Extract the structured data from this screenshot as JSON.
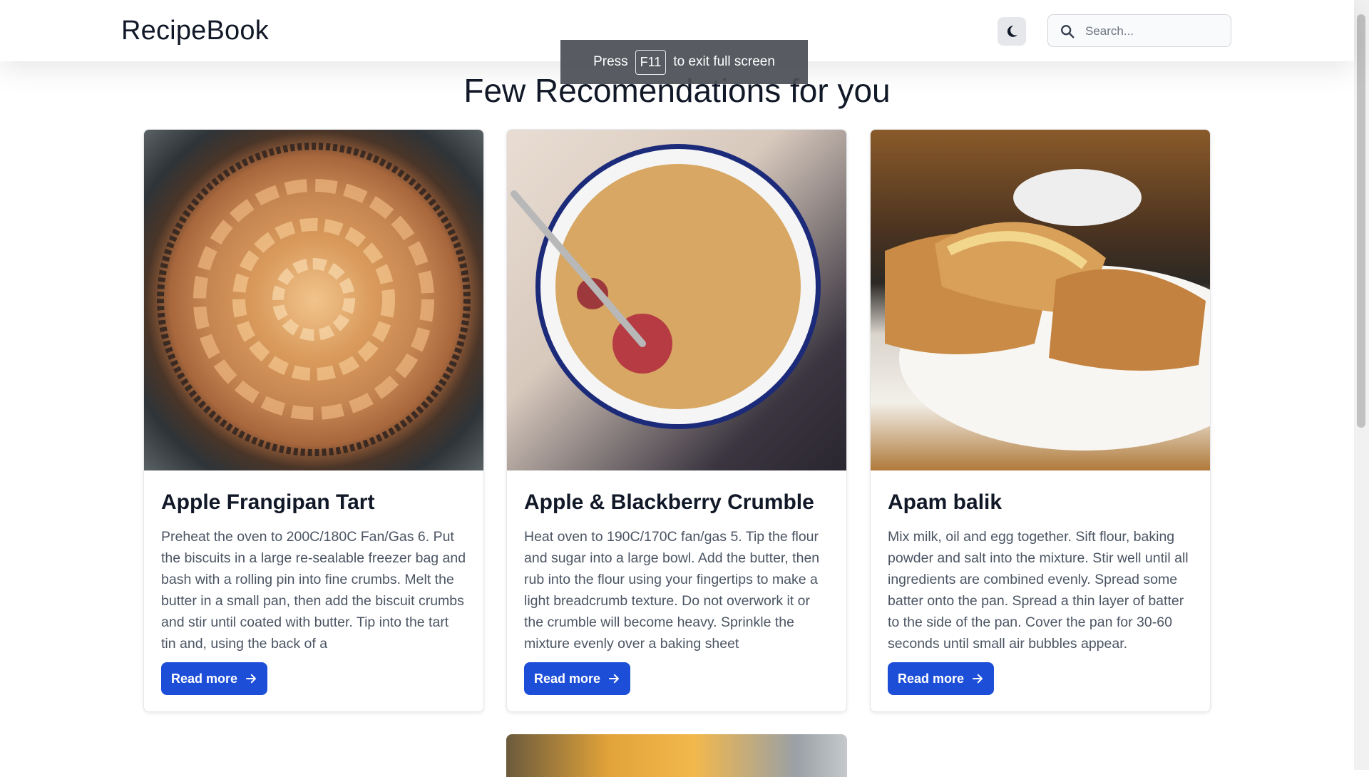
{
  "navbar": {
    "brand": "RecipeBook",
    "search_placeholder": "Search..."
  },
  "fullscreen_toast": {
    "before": "Press",
    "key": "F11",
    "after": "to exit full screen"
  },
  "heading": "Few Recomendations for you",
  "cards": [
    {
      "title": "Apple Frangipan Tart",
      "description": "Preheat the oven to 200C/180C Fan/Gas 6. Put the biscuits in a large re-sealable freezer bag and bash with a rolling pin into fine crumbs. Melt the butter in a small pan, then add the biscuit crumbs and stir until coated with butter. Tip into the tart tin and, using the back of a",
      "button": "Read more"
    },
    {
      "title": "Apple & Blackberry Crumble",
      "description": "Heat oven to 190C/170C fan/gas 5. Tip the flour and sugar into a large bowl. Add the butter, then rub into the flour using your fingertips to make a light breadcrumb texture. Do not overwork it or the crumble will become heavy. Sprinkle the mixture evenly over a baking sheet",
      "button": "Read more"
    },
    {
      "title": "Apam balik",
      "description": "Mix milk, oil and egg together. Sift flour, baking powder and salt into the mixture. Stir well until all ingredients are combined evenly. Spread some batter onto the pan. Spread a thin layer of batter to the side of the pan. Cover the pan for 30-60 seconds until small air bubbles appear.",
      "button": "Read more"
    }
  ],
  "icons": {
    "theme": "moon-icon",
    "search": "search-icon",
    "button": "arrow-right-icon"
  },
  "colors": {
    "primary": "#1d4ed8"
  }
}
